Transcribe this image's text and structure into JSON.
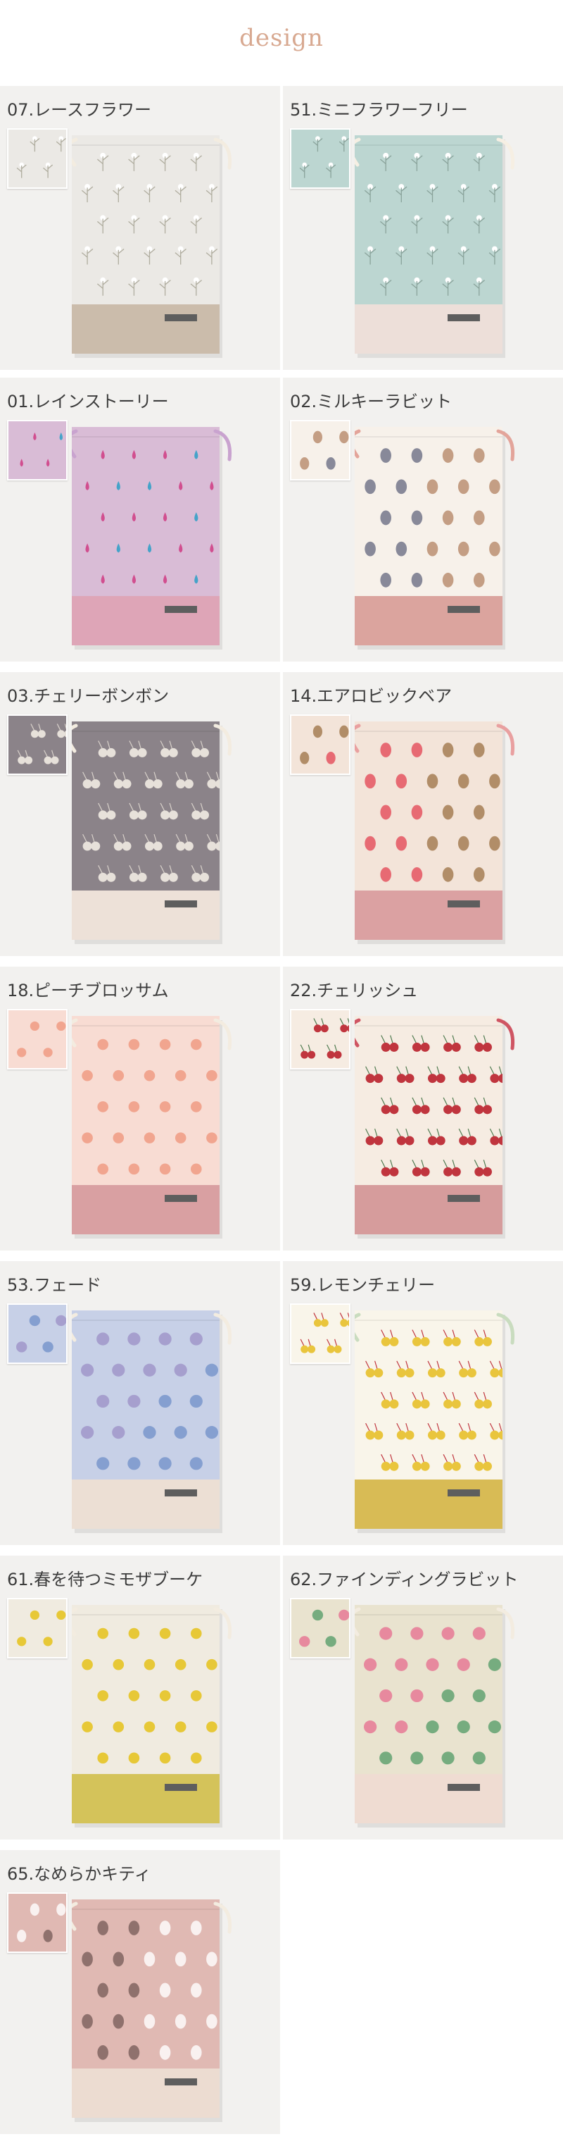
{
  "header": {
    "title": "design"
  },
  "items": [
    {
      "label": "07.レースフラワー",
      "body": "#ebe9e5",
      "bottom": "#cbbcab",
      "cord": "#f3ece0",
      "motif": "#b0ad9f",
      "accent": "#ffffff",
      "pattern": "sprig"
    },
    {
      "label": "51.ミニフラワーフリー",
      "body": "#bcd6d1",
      "bottom": "#eddfd9",
      "cord": "#f6efe3",
      "motif": "#e8e2c9",
      "accent": "#8aa39b",
      "pattern": "sprig"
    },
    {
      "label": "01.レインストーリー",
      "body": "#d9bcd6",
      "bottom": "#dea5b7",
      "cord": "#c9a3cf",
      "motif": "#d14e8f",
      "accent": "#ffffff",
      "pattern": "rain"
    },
    {
      "label": "02.ミルキーラビット",
      "body": "#f7f1ea",
      "bottom": "#dba49e",
      "cord": "#e3a49a",
      "motif": "#b78a6a",
      "accent": "#6b6f85",
      "pattern": "scatter"
    },
    {
      "label": "03.チェリーボンボン",
      "body": "#8b8389",
      "bottom": "#ede1d8",
      "cord": "#f3ece0",
      "motif": "#e7e1da",
      "accent": "#e7e1da",
      "pattern": "cherry"
    },
    {
      "label": "14.エアロビックベア",
      "body": "#f3e4d9",
      "bottom": "#dba1a2",
      "cord": "#e9a0a0",
      "motif": "#a0774b",
      "accent": "#e34b59",
      "pattern": "scatter"
    },
    {
      "label": "18.ピーチブロッサム",
      "body": "#f8dcd3",
      "bottom": "#d9a0a2",
      "cord": "#f3ece0",
      "motif": "#f1a58f",
      "accent": "#a7c28a",
      "pattern": "dots"
    },
    {
      "label": "22.チェリッシュ",
      "body": "#f6ece2",
      "bottom": "#d69c9c",
      "cord": "#cf5563",
      "motif": "#c0353e",
      "accent": "#4f7a4f",
      "pattern": "cherry"
    },
    {
      "label": "53.フェード",
      "body": "#c7d0e7",
      "bottom": "#ecdfd4",
      "cord": "#f3ece0",
      "motif": "#9b8fc6",
      "accent": "#6f8fc8",
      "pattern": "dense"
    },
    {
      "label": "59.レモンチェリー",
      "body": "#f9f5ea",
      "bottom": "#d8bb55",
      "cord": "#c9dcbf",
      "motif": "#e9c53d",
      "accent": "#c0353e",
      "pattern": "cherry"
    },
    {
      "label": "61.春を待つミモザブーケ",
      "body": "#f0ebe0",
      "bottom": "#d4c35a",
      "cord": "#f3ece0",
      "motif": "#e7c837",
      "accent": "#8e9a7a",
      "pattern": "dots"
    },
    {
      "label": "62.ファインディングラビット",
      "body": "#e9e3cf",
      "bottom": "#efdcd2",
      "cord": "#f3ece0",
      "motif": "#e66b8d",
      "accent": "#4f9a64",
      "pattern": "dense"
    },
    {
      "label": "65.なめらかキティ",
      "body": "#e0b9b3",
      "bottom": "#ecdcd1",
      "cord": "#f3ece0",
      "motif": "#ffffff",
      "accent": "#7a5f5b",
      "pattern": "scatter"
    }
  ]
}
